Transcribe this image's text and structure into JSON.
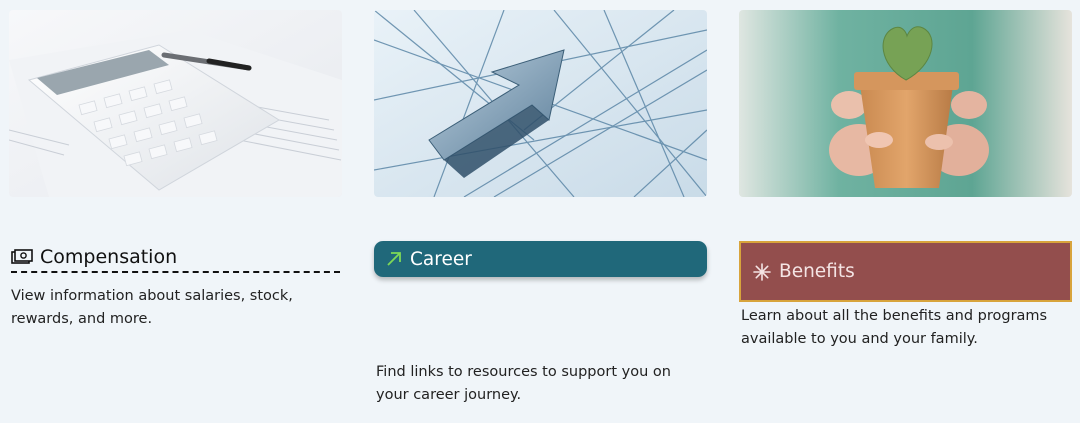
{
  "cards": [
    {
      "id": "compensation",
      "image_alt": "Calculator and pen on paperwork",
      "title": "Compensation",
      "icon": "money-icon",
      "description": "View information about salaries, stock, rewards, and more."
    },
    {
      "id": "career",
      "image_alt": "Metal arrow pointing up on line pattern",
      "title": "Career",
      "icon": "arrow-up-right-icon",
      "description": "Find links to resources to support you on your career journey.",
      "colors": {
        "button_bg": "#20687a",
        "icon": "#7ed957"
      }
    },
    {
      "id": "benefits",
      "image_alt": "Hands holding a potted heart-shaped cactus",
      "title": "Benefits",
      "icon": "asterisk-icon",
      "description": "Learn about all the benefits and programs available to you and your family.",
      "colors": {
        "button_bg": "#934e4d",
        "border": "#d8a43c"
      }
    }
  ]
}
